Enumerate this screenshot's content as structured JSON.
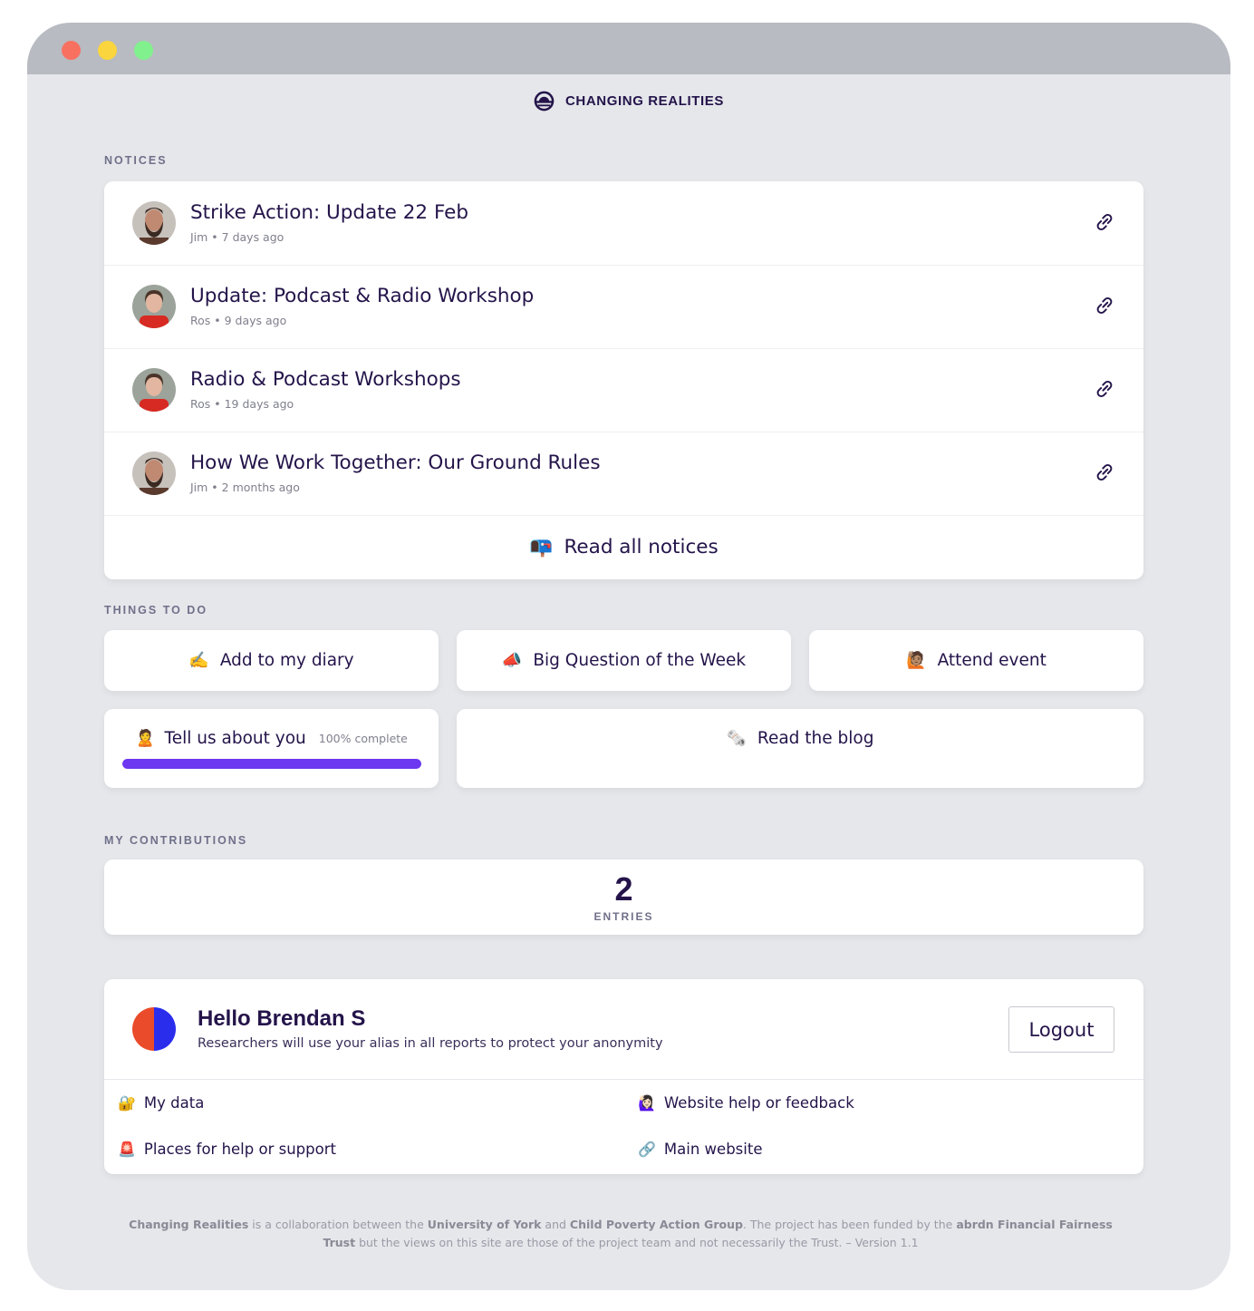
{
  "app": {
    "brand": "CHANGING REALITIES"
  },
  "notices": {
    "section_label": "NOTICES",
    "items": [
      {
        "title": "Strike Action: Update 22 Feb",
        "author": "Jim",
        "age": "7 days ago",
        "meta": "Jim • 7 days ago",
        "avatar": "jim"
      },
      {
        "title": "Update: Podcast & Radio Workshop",
        "author": "Ros",
        "age": "9 days ago",
        "meta": "Ros • 9 days ago",
        "avatar": "ros"
      },
      {
        "title": "Radio & Podcast Workshops",
        "author": "Ros",
        "age": "19 days ago",
        "meta": "Ros • 19 days ago",
        "avatar": "ros"
      },
      {
        "title": "How We Work Together: Our Ground Rules",
        "author": "Jim",
        "age": "2 months ago",
        "meta": "Jim • 2 months ago",
        "avatar": "jim"
      }
    ],
    "read_all": {
      "label": "Read all notices",
      "emoji": "📭"
    }
  },
  "todo": {
    "section_label": "THINGS TO DO",
    "items": [
      {
        "label": "Add to my diary",
        "emoji": "✍️"
      },
      {
        "label": "Big Question of the Week",
        "emoji": "📣"
      },
      {
        "label": "Attend event",
        "emoji": "🙋🏽"
      },
      {
        "label": "Tell us about you",
        "emoji": "🙎",
        "progress_text": "100% complete",
        "progress": 1.0
      },
      {
        "label": "Read the blog",
        "emoji": "🗞️"
      }
    ]
  },
  "contributions": {
    "section_label": "MY CONTRIBUTIONS",
    "count": "2",
    "unit": "ENTRIES"
  },
  "profile": {
    "greeting": "Hello Brendan S",
    "subtitle": "Researchers will use your alias in all reports to protect your anonymity",
    "logout_label": "Logout",
    "avatar_colors": [
      "#ea4b2b",
      "#2b2ded"
    ],
    "links": [
      {
        "label": "My data",
        "emoji": "🔐"
      },
      {
        "label": "Website help or feedback",
        "emoji": "🙋🏻‍♀️"
      },
      {
        "label": "Places for help or support",
        "emoji": "🚨"
      },
      {
        "label": "Main website",
        "emoji": "🔗"
      }
    ]
  },
  "footer": {
    "org": "Changing Realities",
    "t1": " is a collaboration between the ",
    "uni": "University of York",
    "t2": " and ",
    "cpag": "Child Poverty Action Group",
    "t3": ". The project has been funded by the ",
    "funder": "abrdn Financial Fairness Trust",
    "t4": " but the views on this site are those of the project team and not necessarily the Trust. – Version 1.1"
  },
  "colors": {
    "accent": "#6d36f0",
    "text": "#24144a",
    "background": "#e5e7eb"
  }
}
